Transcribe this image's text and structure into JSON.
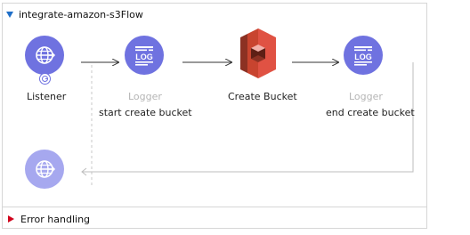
{
  "flow": {
    "title": "integrate-amazon-s3Flow",
    "error_handling": "Error handling"
  },
  "components": {
    "listener": {
      "label": "Listener",
      "icon": "globe-icon"
    },
    "logger_start": {
      "type_label": "Logger",
      "label": "start create bucket",
      "icon": "log-icon"
    },
    "create_bucket": {
      "label": "Create Bucket",
      "icon": "amazon-s3-icon"
    },
    "logger_end": {
      "type_label": "Logger",
      "label": "end create bucket",
      "icon": "log-icon"
    },
    "response": {
      "icon": "globe-icon"
    }
  },
  "colors": {
    "component_fill": "#6f72e0",
    "component_faded": "#a6a8ef",
    "s3_red": "#e05243",
    "flow_triangle": "#1f6fc8",
    "error_triangle": "#d0021b"
  }
}
